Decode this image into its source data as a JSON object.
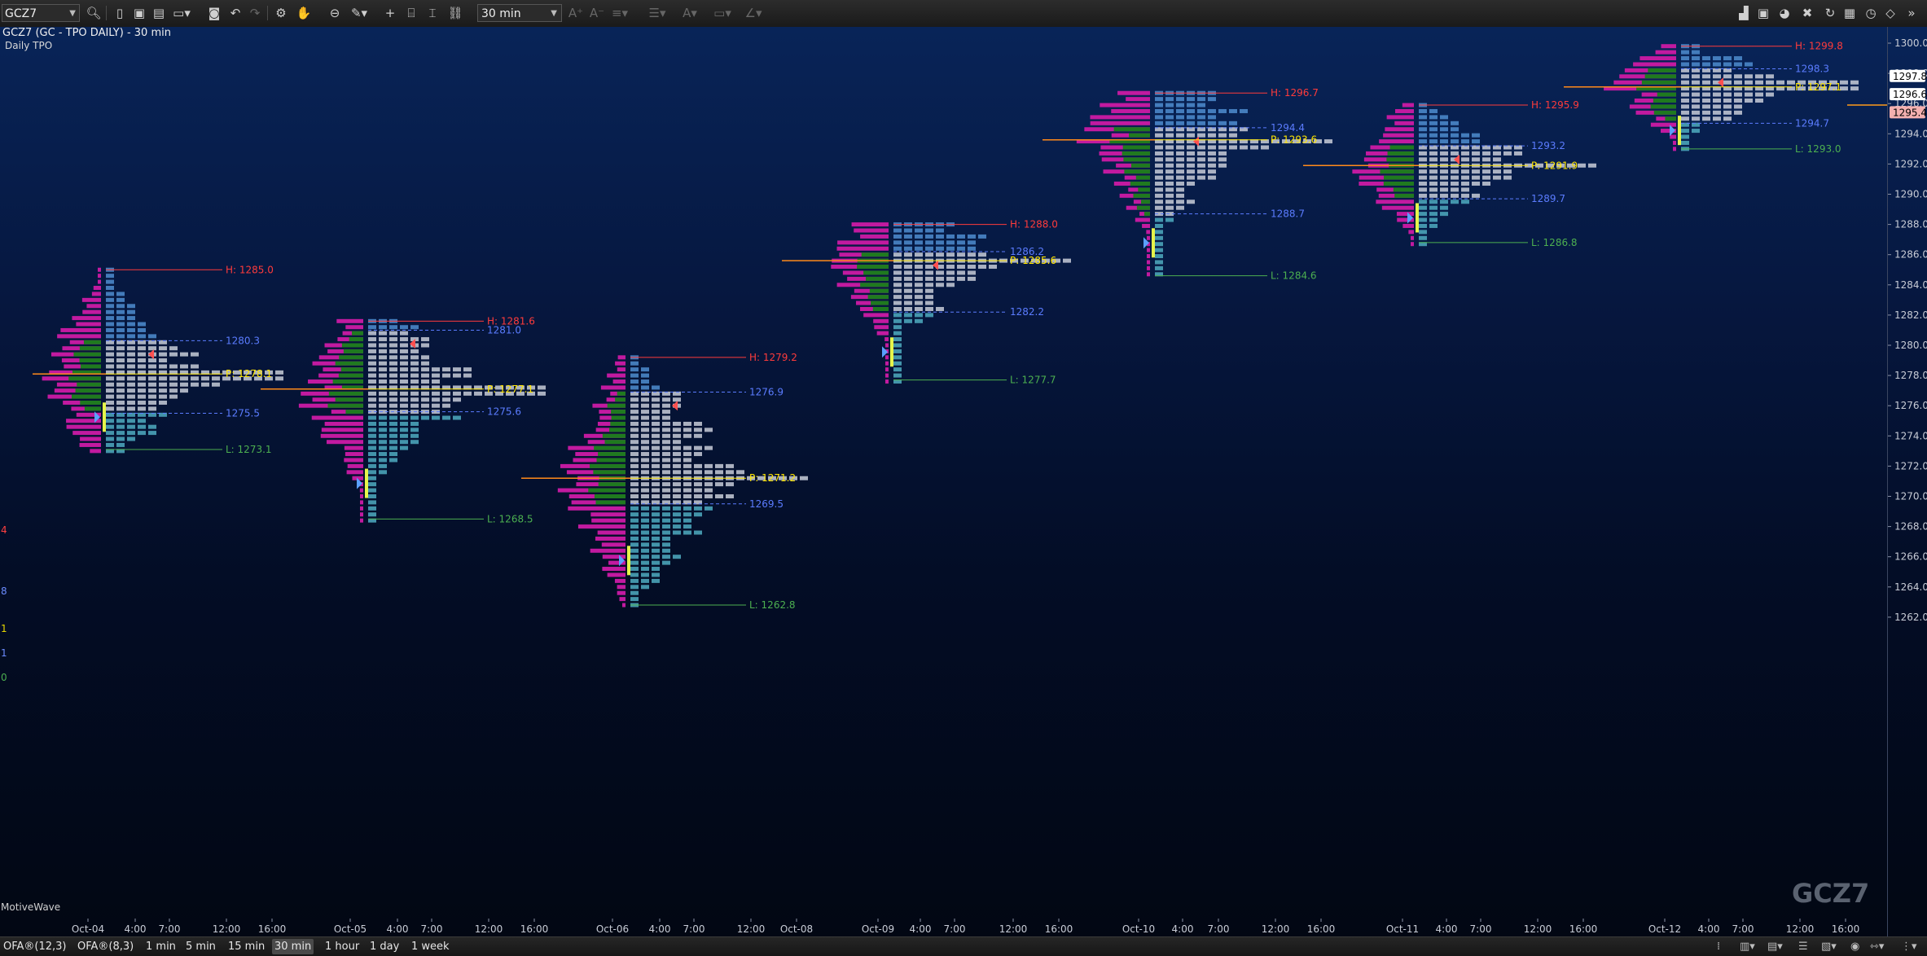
{
  "toolbar": {
    "symbol": "GCZ7",
    "bar_size": "30 min"
  },
  "chart": {
    "title": "GCZ7 (GC - TPO DAILY) - 30 min",
    "subtitle": "Daily TPO",
    "watermark": "GCZ7",
    "attribution": "MotiveWave",
    "price_axis": {
      "labels": [
        "1300.0",
        "1298.0",
        "1296.0",
        "1294.0",
        "1292.0",
        "1290.0",
        "1288.0",
        "1286.0",
        "1284.0",
        "1282.0",
        "1280.0",
        "1278.0",
        "1276.0",
        "1274.0",
        "1272.0",
        "1270.0",
        "1268.0",
        "1266.0",
        "1264.0",
        "1262.0"
      ],
      "tags": [
        {
          "text": "1297.8",
          "color": "#ffffff",
          "text_color": "#000000"
        },
        {
          "text": "1296.6",
          "color": "#ffffff",
          "text_color": "#000000"
        },
        {
          "text": "1295.4",
          "color": "#f4b0b0",
          "text_color": "#000000"
        }
      ]
    },
    "time_axis": {
      "labels": [
        "Oct-04",
        "4:00",
        "7:00",
        "12:00",
        "16:00",
        "Oct-05",
        "4:00",
        "7:00",
        "12:00",
        "16:00",
        "Oct-06",
        "4:00",
        "7:00",
        "12:00",
        "Oct-08",
        "Oct-09",
        "4:00",
        "7:00",
        "12:00",
        "16:00",
        "Oct-10",
        "4:00",
        "7:00",
        "12:00",
        "16:00",
        "Oct-11",
        "4:00",
        "7:00",
        "12:00",
        "16:00",
        "Oct-12",
        "4:00",
        "7:00",
        "12:00",
        "16:00"
      ]
    },
    "left_edge_values": [
      {
        "text": "4",
        "color": "#ff4040"
      },
      {
        "text": "8",
        "color": "#6b8cff"
      },
      {
        "text": "1",
        "color": "#e8d800"
      },
      {
        "text": "1",
        "color": "#6b8cff"
      },
      {
        "text": "0",
        "color": "#4caf50"
      }
    ],
    "sessions": [
      {
        "date": "Oct-04",
        "high": "H: 1285.0",
        "vah": "1280.3",
        "poc": "P: 1278.1",
        "val": "1275.5",
        "low": "L: 1273.1"
      },
      {
        "date": "Oct-05",
        "high": "H: 1281.6",
        "vah": "1281.0",
        "poc": "P: 1277.1",
        "val": "1275.6",
        "low": "L: 1268.5"
      },
      {
        "date": "Oct-06",
        "high": "H: 1279.2",
        "vah": "1276.9",
        "poc": "P: 1271.2",
        "val": "1269.5",
        "low": "L: 1262.8"
      },
      {
        "date": "Oct-09",
        "high": "H: 1288.0",
        "vah": "1286.2",
        "poc": "P: 1285.6",
        "val": "1282.2",
        "low": "L: 1277.7"
      },
      {
        "date": "Oct-10",
        "high": "H: 1296.7",
        "vah": "1294.4",
        "poc": "P: 1293.6",
        "val": "1288.7",
        "low": "L: 1284.6"
      },
      {
        "date": "Oct-11",
        "high": "H: 1295.9",
        "vah": "1293.2",
        "poc": "P: 1291.9",
        "val": "1289.7",
        "low": "L: 1286.8"
      },
      {
        "date": "Oct-12",
        "high": "H: 1299.8",
        "vah": "1298.3",
        "poc": "P: 1297.1",
        "val": "1294.7",
        "low": "L: 1293.0"
      }
    ],
    "colors": {
      "high": "#ff3b3b",
      "vah_val": "#5b7cff",
      "poc": "#ffe600",
      "low": "#4caf50",
      "volume": "#c21aa0",
      "volume_value_area": "#1f7a1f",
      "tpo_light": "#c8ccd8",
      "tpo_blue": "#4a86c8",
      "tpo_teal": "#4aa3b8"
    }
  },
  "statusbar": {
    "items": [
      {
        "label": "OFA®(12,3)",
        "active": false
      },
      {
        "label": "OFA®(8,3)",
        "active": false
      },
      {
        "label": "1 min",
        "active": false
      },
      {
        "label": "5 min",
        "active": false
      },
      {
        "label": "15 min",
        "active": false
      },
      {
        "label": "30 min",
        "active": true
      },
      {
        "label": "1 hour",
        "active": false
      },
      {
        "label": "1 day",
        "active": false
      },
      {
        "label": "1 week",
        "active": false
      }
    ]
  }
}
